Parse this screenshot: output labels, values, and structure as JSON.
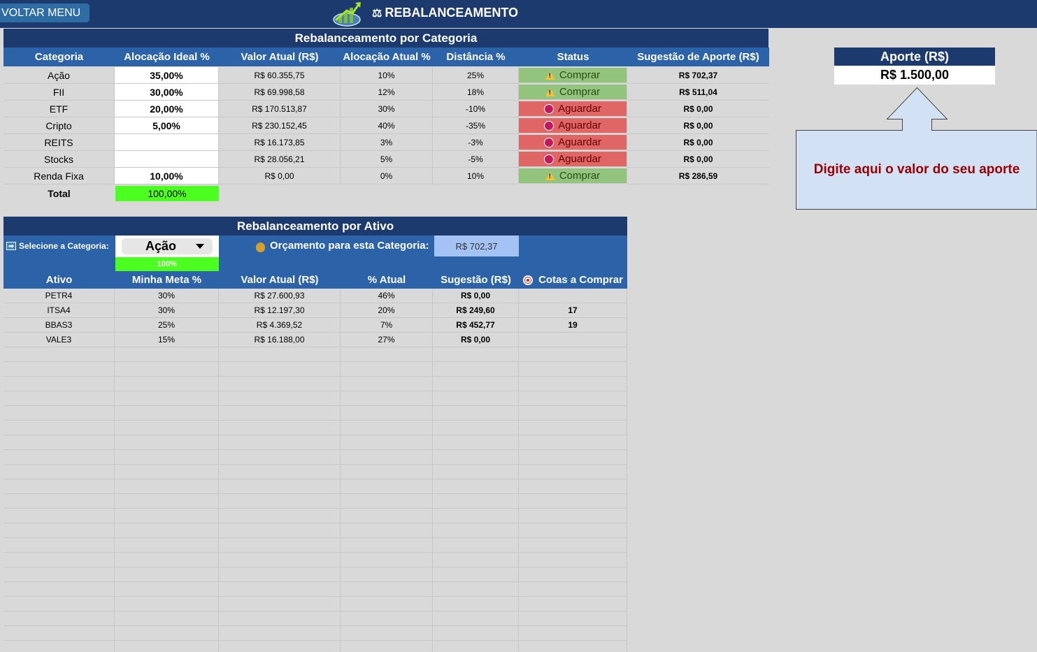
{
  "header": {
    "menu_button": "VOLTAR MENU",
    "title": "REBALANCEAMENTO"
  },
  "category_section": {
    "title": "Rebalanceamento por Categoria",
    "columns": [
      "Categoria",
      "Alocação Ideal %",
      "Valor Atual (R$)",
      "Alocação Atual %",
      "Distância %",
      "Status",
      "Sugestão de Aporte (R$)"
    ],
    "rows": [
      {
        "categoria": "Ação",
        "ideal": "35,00%",
        "valor": "R$ 60.355,75",
        "atual": "10%",
        "dist": "25%",
        "status": "Comprar",
        "status_type": "buy",
        "sugestao": "R$ 702,37"
      },
      {
        "categoria": "FII",
        "ideal": "30,00%",
        "valor": "R$ 69.998,58",
        "atual": "12%",
        "dist": "18%",
        "status": "Comprar",
        "status_type": "buy",
        "sugestao": "R$ 511,04"
      },
      {
        "categoria": "ETF",
        "ideal": "20,00%",
        "valor": "R$ 170.513,87",
        "atual": "30%",
        "dist": "-10%",
        "status": "Aguardar",
        "status_type": "wait",
        "sugestao": "R$ 0,00"
      },
      {
        "categoria": "Cripto",
        "ideal": "5,00%",
        "valor": "R$ 230.152,45",
        "atual": "40%",
        "dist": "-35%",
        "status": "Aguardar",
        "status_type": "wait",
        "sugestao": "R$ 0,00"
      },
      {
        "categoria": "REITS",
        "ideal": "",
        "valor": "R$ 16.173,85",
        "atual": "3%",
        "dist": "-3%",
        "status": "Aguardar",
        "status_type": "wait",
        "sugestao": "R$ 0,00"
      },
      {
        "categoria": "Stocks",
        "ideal": "",
        "valor": "R$ 28.056,21",
        "atual": "5%",
        "dist": "-5%",
        "status": "Aguardar",
        "status_type": "wait",
        "sugestao": "R$ 0,00"
      },
      {
        "categoria": "Renda Fixa",
        "ideal": "10,00%",
        "valor": "R$ 0,00",
        "atual": "0%",
        "dist": "10%",
        "status": "Comprar",
        "status_type": "buy",
        "sugestao": "R$ 286,59"
      }
    ],
    "total_label": "Total",
    "total_value": "100,00%"
  },
  "aporte": {
    "label": "Aporte (R$)",
    "value": "R$ 1.500,00",
    "callout": "Digite aqui o valor do seu aporte"
  },
  "asset_section": {
    "title": "Rebalanceamento por Ativo",
    "select_label": "Selecione a Categoria:",
    "selected_category": "Ação",
    "budget_label": "Orçamento para esta Categoria:",
    "budget_value": "R$ 702,37",
    "meta_total": "100%",
    "columns": [
      "Ativo",
      "Minha Meta %",
      "Valor Atual (R$)",
      "% Atual",
      "Sugestão (R$)",
      "Cotas a Comprar"
    ],
    "rows": [
      {
        "ativo": "PETR4",
        "meta": "30%",
        "valor": "R$ 27.600,93",
        "atual": "46%",
        "sugestao": "R$ 0,00",
        "cotas": ""
      },
      {
        "ativo": "ITSA4",
        "meta": "30%",
        "valor": "R$ 12.197,30",
        "atual": "20%",
        "sugestao": "R$ 249,60",
        "cotas": "17"
      },
      {
        "ativo": "BBAS3",
        "meta": "25%",
        "valor": "R$ 4.369,52",
        "atual": "7%",
        "sugestao": "R$ 452,77",
        "cotas": "19"
      },
      {
        "ativo": "VALE3",
        "meta": "15%",
        "valor": "R$ 16.188,00",
        "atual": "27%",
        "sugestao": "R$ 0,00",
        "cotas": ""
      }
    ]
  },
  "icons": {
    "menu": "voltar-menu",
    "logo": "growth-chart-logo",
    "title": "balance-scale-icon",
    "warning": "warning-icon",
    "wait": "red-circle-icon",
    "select": "arrow-right-icon",
    "budget": "money-bag-icon",
    "target": "target-icon"
  }
}
